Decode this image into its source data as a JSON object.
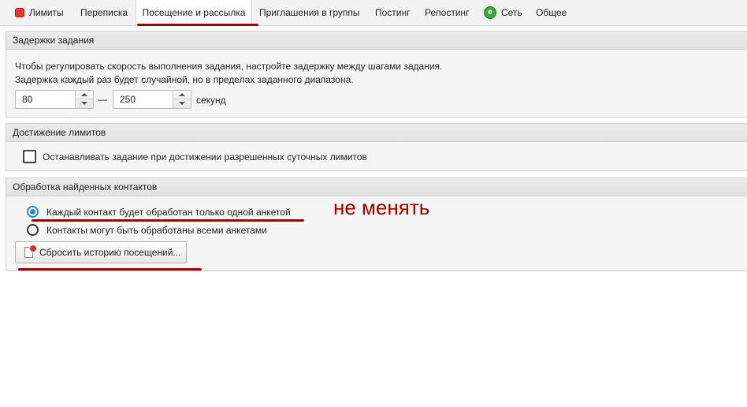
{
  "tabs": [
    {
      "label": "Лимиты",
      "icon": "limits-icon",
      "active": false
    },
    {
      "label": "Переписка",
      "active": false
    },
    {
      "label": "Посещение и рассылка",
      "active": true
    },
    {
      "label": "Приглашения в группы",
      "active": false
    },
    {
      "label": "Постинг",
      "active": false
    },
    {
      "label": "Репостинг",
      "active": false
    },
    {
      "label": "Сеть",
      "icon": "network-icon",
      "active": false
    },
    {
      "label": "Общее",
      "active": false
    }
  ],
  "delays": {
    "title": "Задержки задания",
    "line1": "Чтобы регулировать скорость выполнения задания, настройте задержку между шагами задания.",
    "line2": "Задержка каждый раз будет случайной, но в пределах заданного диапазона.",
    "min_value": "80",
    "separator": "—",
    "max_value": "250",
    "unit": "секунд"
  },
  "limits": {
    "title": "Достижение лимитов",
    "checkbox_label": "Останавливать задание при достижении разрешенных суточных лимитов",
    "checked": false
  },
  "contacts": {
    "title": "Обработка найденных контактов",
    "option1": "Каждый контакт будет обработан только одной анкетой",
    "option2": "Контакты могут быть обработаны всеми анкетами",
    "selected": 1,
    "reset_button": "Сбросить историю посещений..."
  },
  "annotation": "не менять",
  "colors": {
    "accent_red": "#a00000",
    "radio_blue": "#2a87d0",
    "limits_icon": "#e53935",
    "network_icon": "#3aa73a"
  }
}
